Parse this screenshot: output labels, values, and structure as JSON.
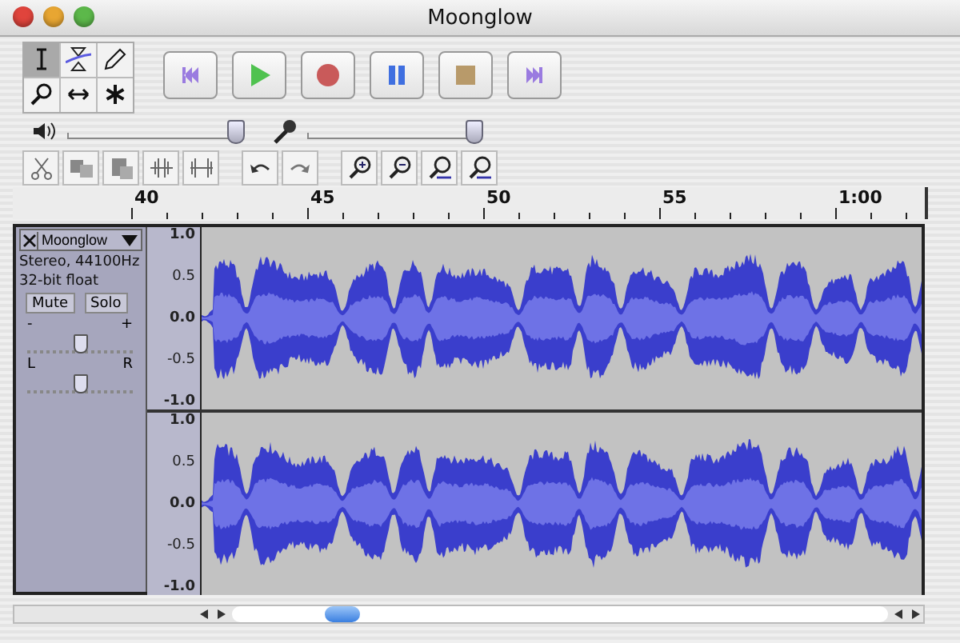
{
  "window": {
    "title": "Moonglow"
  },
  "tools": [
    {
      "kind": "select",
      "selected": true
    },
    {
      "kind": "envelope",
      "selected": false
    },
    {
      "kind": "draw",
      "selected": false
    },
    {
      "kind": "zoom",
      "selected": false
    },
    {
      "kind": "shift",
      "selected": false
    },
    {
      "kind": "multi",
      "selected": false
    }
  ],
  "transport": [
    {
      "kind": "start"
    },
    {
      "kind": "play"
    },
    {
      "kind": "record"
    },
    {
      "kind": "pause"
    },
    {
      "kind": "stop"
    },
    {
      "kind": "end"
    }
  ],
  "meters": [
    {
      "kind": "output",
      "level": 0.97
    },
    {
      "kind": "input",
      "level": 0.96
    }
  ],
  "edit_tools": [
    {
      "kind": "cut"
    },
    {
      "kind": "copy"
    },
    {
      "kind": "paste"
    },
    {
      "kind": "trim"
    },
    {
      "kind": "silence"
    },
    {
      "kind": "undo"
    },
    {
      "kind": "redo"
    },
    {
      "kind": "zoomin"
    },
    {
      "kind": "zoomout"
    },
    {
      "kind": "fit"
    },
    {
      "kind": "zoomsel"
    }
  ],
  "ruler": {
    "labels": [
      "40",
      "45",
      "50",
      "55",
      "1:00"
    ]
  },
  "track": {
    "name": "Moonglow",
    "format": "Stereo, 44100Hz",
    "sample_format": "32-bit float",
    "buttons": [
      "Mute",
      "Solo"
    ],
    "gain": {
      "min_label": "-",
      "max_label": "+",
      "level": 0.5
    },
    "pan": {
      "min_label": "L",
      "max_label": "R",
      "level": 0.5
    },
    "channels": [
      {
        "scale": [
          "1.0",
          "0.5",
          "0.0",
          "-0.5",
          "-1.0"
        ]
      },
      {
        "scale": [
          "1.0",
          "0.5",
          "0.0",
          "-0.5",
          "-1.0"
        ]
      }
    ]
  }
}
